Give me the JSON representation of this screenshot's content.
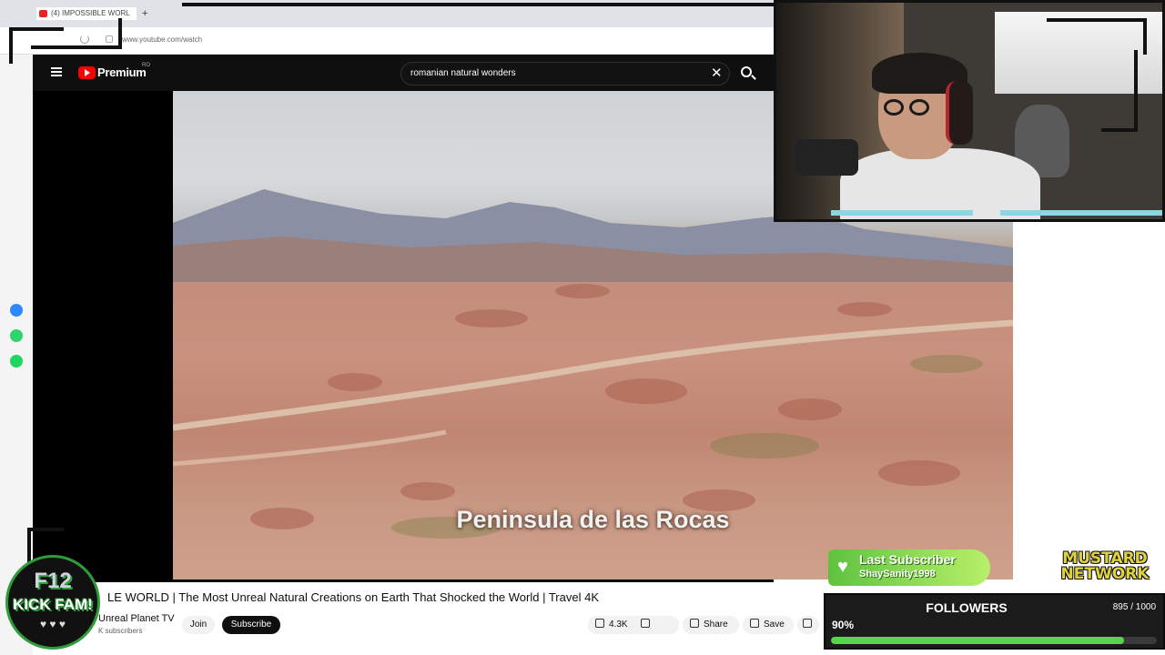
{
  "browser": {
    "tab_title": "(4) IMPOSSIBLE WORL",
    "new_tab": "+",
    "url": "www.youtube.com/watch"
  },
  "youtube": {
    "brand": "Premium",
    "region": "RO",
    "search_query": "romanian natural wonders",
    "clear_symbol": "✕"
  },
  "video": {
    "caption": "Peninsula de las Rocas"
  },
  "below_video": {
    "title": "LE WORLD | The Most Unreal Natural Creations on Earth That Shocked the World | Travel 4K",
    "channel": "Unreal Planet TV",
    "subscribers": "K subscribers",
    "join_label": "Join",
    "subscribe_label": "Subscribe",
    "likes": "4.3K",
    "share_label": "Share",
    "save_label": "Save"
  },
  "overlay": {
    "last_subscriber_title": "Last Subscriber",
    "last_subscriber_name": "ShaySanity1998",
    "logo_line1": "MUSTARD",
    "logo_line2": "NETWORK",
    "followers_title": "FOLLOWERS",
    "followers_count": "895 / 1000",
    "followers_percent_label": "90%",
    "followers_progress": 0.9,
    "badge_line1": "F12",
    "badge_line2": "KICK FAM!",
    "badge_hearts": "♥ ♥ ♥"
  },
  "colors": {
    "youtube_red": "#ff0000",
    "progress_green": "#58d34a",
    "sub_green": "#5fc23f",
    "cam_bar": "#8ad6e3"
  }
}
